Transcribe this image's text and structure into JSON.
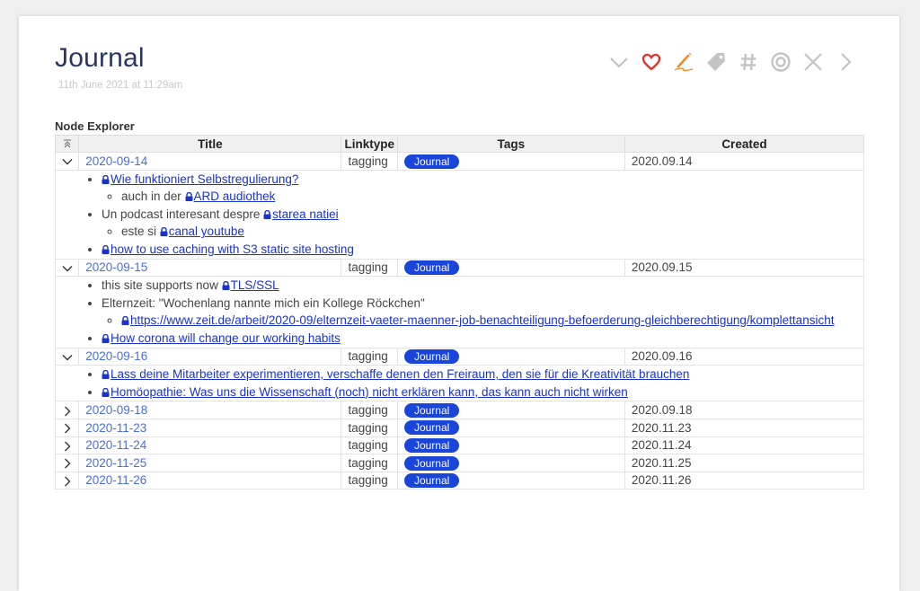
{
  "header": {
    "title": "Journal",
    "subtitle": "11th June 2021 at 11:29am"
  },
  "toolbar": {
    "buttons": [
      {
        "name": "collapse",
        "icon": "chevron-down-icon",
        "color": "#c4c4c4"
      },
      {
        "name": "favorite",
        "icon": "heart-icon",
        "color": "#e0322a"
      },
      {
        "name": "edit",
        "icon": "pencil-icon",
        "color": "#ee8c2c"
      },
      {
        "name": "tag",
        "icon": "tag-icon",
        "color": "#c4c4c4"
      },
      {
        "name": "hashtag",
        "icon": "hash-icon",
        "color": "#c4c4c4"
      },
      {
        "name": "target",
        "icon": "target-icon",
        "color": "#c4c4c4"
      },
      {
        "name": "close",
        "icon": "close-icon",
        "color": "#c4c4c4"
      },
      {
        "name": "next",
        "icon": "chevron-right-icon",
        "color": "#c4c4c4"
      }
    ]
  },
  "explorer": {
    "label": "Node Explorer",
    "columns": [
      "Title",
      "Linktype",
      "Tags",
      "Created"
    ],
    "rows": [
      {
        "title": "2020-09-14",
        "linktype": "tagging",
        "tag": "Journal",
        "created": "2020.09.14",
        "expanded": true,
        "items": [
          {
            "text": "",
            "link": "Wie funktioniert Selbstregulierung?",
            "children": [
              {
                "text": "auch in der ",
                "link": "ARD audiothek"
              }
            ]
          },
          {
            "text": "Un podcast interesant despre ",
            "link": "starea natiei",
            "children": [
              {
                "text": "este si ",
                "link": "canal youtube"
              }
            ]
          },
          {
            "text": "",
            "link": "how to use caching with S3 static site hosting",
            "children": []
          }
        ]
      },
      {
        "title": "2020-09-15",
        "linktype": "tagging",
        "tag": "Journal",
        "created": "2020.09.15",
        "expanded": true,
        "items": [
          {
            "text": "this site supports now ",
            "link": "TLS/SSL",
            "children": []
          },
          {
            "text": "Elternzeit: \"Wochenlang nannte mich ein Kollege Röckchen\"",
            "link": "",
            "children": [
              {
                "text": "",
                "link": "https://www.zeit.de/arbeit/2020-09/elternzeit-vaeter-maenner-job-benachteiligung-befoerderung-gleichberechtigung/komplettansicht"
              }
            ]
          },
          {
            "text": "",
            "link": "How corona will change our working habits",
            "children": []
          }
        ]
      },
      {
        "title": "2020-09-16",
        "linktype": "tagging",
        "tag": "Journal",
        "created": "2020.09.16",
        "expanded": true,
        "items": [
          {
            "text": "",
            "link": "Lass deine Mitarbeiter experimentieren, verschaffe denen den Freiraum, den sie für die Kreativität brauchen",
            "children": []
          },
          {
            "text": "",
            "link": "Homöopathie: Was uns die Wissenschaft (noch) nicht erklären kann, das kann auch nicht wirken",
            "children": []
          }
        ]
      },
      {
        "title": "2020-09-18",
        "linktype": "tagging",
        "tag": "Journal",
        "created": "2020.09.18",
        "expanded": false,
        "items": []
      },
      {
        "title": "2020-11-23",
        "linktype": "tagging",
        "tag": "Journal",
        "created": "2020.11.23",
        "expanded": false,
        "items": []
      },
      {
        "title": "2020-11-24",
        "linktype": "tagging",
        "tag": "Journal",
        "created": "2020.11.24",
        "expanded": false,
        "items": []
      },
      {
        "title": "2020-11-25",
        "linktype": "tagging",
        "tag": "Journal",
        "created": "2020.11.25",
        "expanded": false,
        "items": []
      },
      {
        "title": "2020-11-26",
        "linktype": "tagging",
        "tag": "Journal",
        "created": "2020.11.26",
        "expanded": false,
        "items": []
      }
    ]
  }
}
